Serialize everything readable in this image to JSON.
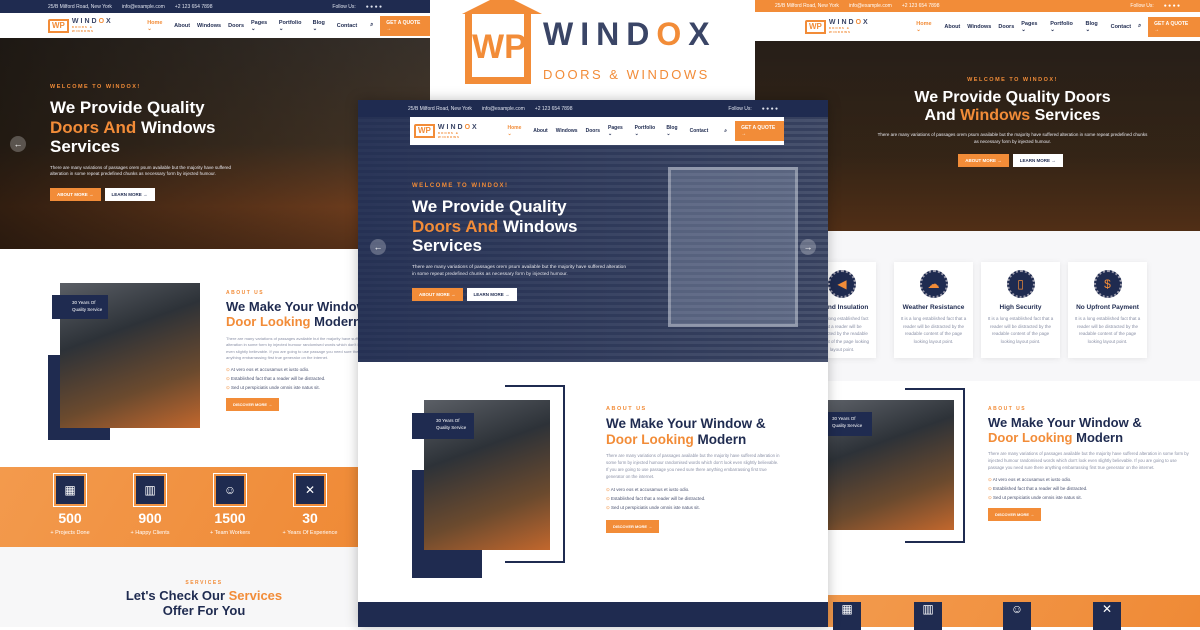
{
  "brand": {
    "name_a": "WIND",
    "name_o": "O",
    "name_x": "X",
    "tagline": "DOORS & WINDOWS",
    "mark": "WP"
  },
  "topbar": {
    "address": "25/B Milford Road, New York",
    "email": "info@example.com",
    "phone": "+2 123 654 7898",
    "follow": "Follow Us:"
  },
  "nav": {
    "items": [
      "Home ⌄",
      "About",
      "Windows",
      "Doors",
      "Pages ⌄",
      "Portfolio ⌄",
      "Blog ⌄",
      "Contact"
    ],
    "quote": "GET A QUOTE →"
  },
  "hero": {
    "welcome": "WELCOME TO WINDOX!",
    "title_a": "We Provide Quality",
    "title_b_or": "Doors And",
    "title_b": " Windows",
    "title_c": "Services",
    "desc": "There are many variations of passages orem psum available but the majority have suffered alteration in some repeat predefined chunks as necessary form by injected humour.",
    "about_btn": "ABOUT MORE →",
    "learn_btn": "LEARN MORE →"
  },
  "hero_right": {
    "title_a": "We Provide Quality Doors",
    "title_b": "And ",
    "title_b_or": "Windows",
    "title_c": " Services"
  },
  "about": {
    "tag": "ABOUT US",
    "title_a": "We Make Your Window &",
    "title_b_or": "Door Looking",
    "title_b": " Modern",
    "desc": "There are many variations of passages available but the majority have suffered alteration in some form by injected humour randomised words which don't look even slightly believable. If you are going to use passage you need sure there anything embarrassing first true generator on the internet.",
    "checks": [
      "At vero eos et accusamus et iusto odio.",
      "Established fact that a reader will be distracted.",
      "Sed ut perspiciatis unde omnis iste natus sit."
    ],
    "btn": "DISCOVER MORE →",
    "badge": "30 Years Of Quality Service"
  },
  "features": [
    {
      "icon": "speaker-icon",
      "title": "Sound Insulation",
      "desc": "It is a long established fact that a reader will be distracted by the readable content of the page looking layout point."
    },
    {
      "icon": "weather-icon",
      "title": "Weather Resistance",
      "desc": "It is a long established fact that a reader will be distracted by the readable content of the page looking layout point."
    },
    {
      "icon": "door-icon",
      "title": "High Security",
      "desc": "It is a long established fact that a reader will be distracted by the readable content of the page looking layout point."
    },
    {
      "icon": "money-icon",
      "title": "No Upfront Payment",
      "desc": "It is a long established fact that a reader will be distracted by the readable content of the page looking layout point."
    }
  ],
  "stats": [
    {
      "n": "500",
      "l": "+ Projects Done"
    },
    {
      "n": "900",
      "l": "+ Happy Clients"
    },
    {
      "n": "1500",
      "l": "+ Team Workers"
    },
    {
      "n": "30",
      "l": "+ Years Of Experience"
    }
  ],
  "services": {
    "tag": "SERVICES",
    "title_a": "Let's Check Our ",
    "title_or": "Services",
    "title_b": "Offer For You"
  },
  "colors": {
    "navy": "#1f2b50",
    "orange": "#f28c38"
  }
}
